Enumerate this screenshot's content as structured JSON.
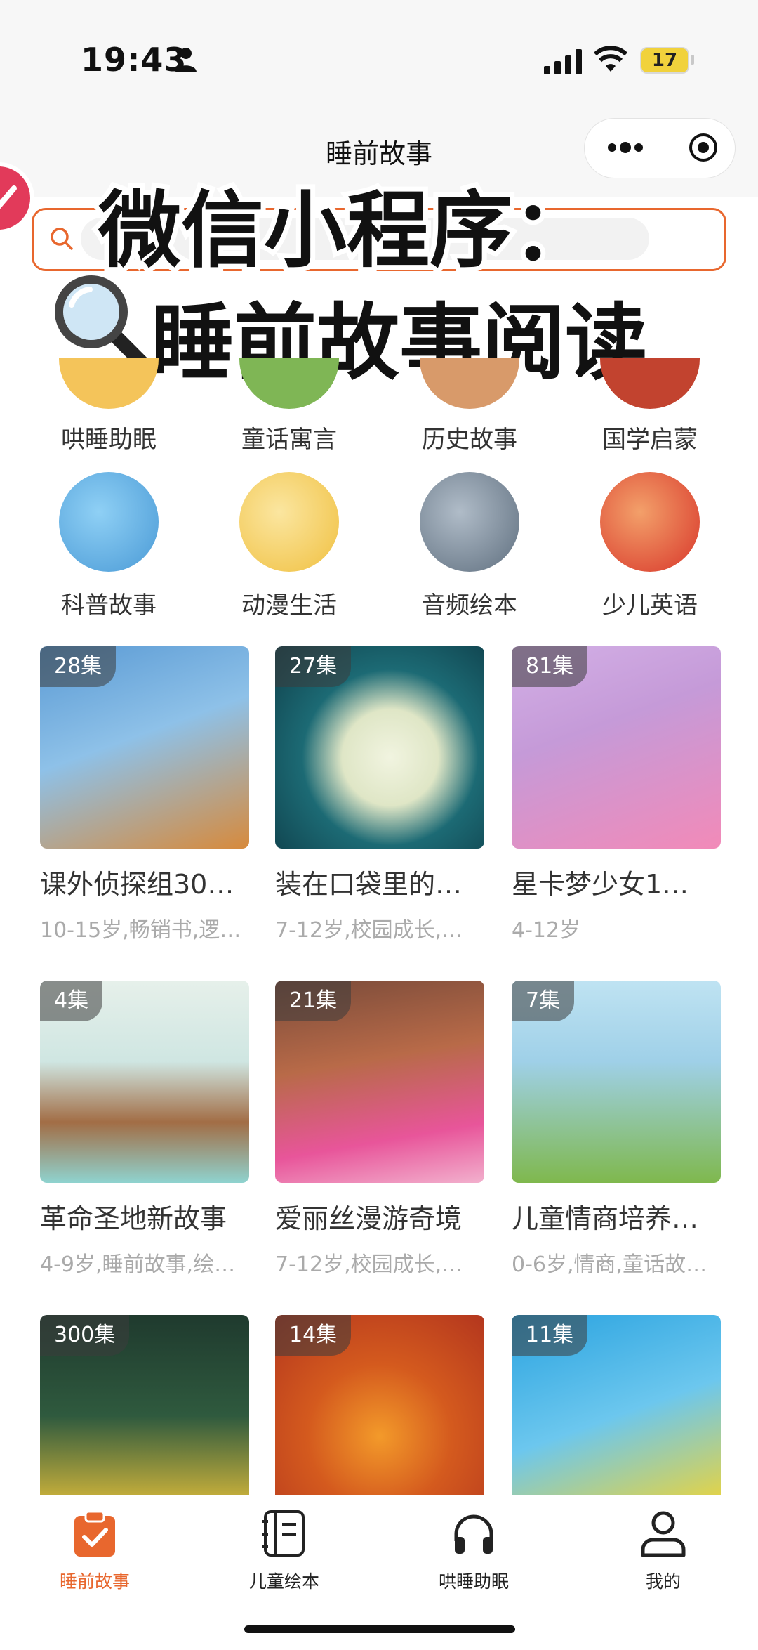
{
  "status_bar": {
    "time": "19:43",
    "battery": "17"
  },
  "nav": {
    "title": "睡前故事"
  },
  "search": {
    "placeholder": ""
  },
  "overlay": {
    "line1": "微信小程序：",
    "line2": "睡前故事阅读"
  },
  "categories": [
    {
      "label": "哄睡助眠",
      "color": "#f4c45a"
    },
    {
      "label": "童话寓言",
      "color": "#7fb655"
    },
    {
      "label": "历史故事",
      "color": "#d89a6a"
    },
    {
      "label": "国学启蒙",
      "color": "#c2432f"
    },
    {
      "label": "科普故事",
      "color": "#4a9ad6"
    },
    {
      "label": "动漫生活",
      "color": "#f0c040"
    },
    {
      "label": "音频绘本",
      "color": "#6f7f8f"
    },
    {
      "label": "少儿英语",
      "color": "#d8362a"
    }
  ],
  "books": [
    {
      "badge": "28集",
      "title": "课外侦探组30…",
      "tags": "10-15岁,畅销书,逻…",
      "c1": "#5a9ad4",
      "c2": "#d78a3c"
    },
    {
      "badge": "27集",
      "title": "装在口袋里的…",
      "tags": "7-12岁,校园成长,…",
      "c1": "#0f4f5f",
      "c2": "#e9eed8"
    },
    {
      "badge": "81集",
      "title": "星卡梦少女1…",
      "tags": "4-12岁",
      "c1": "#c59ad8",
      "c2": "#f28ab8"
    },
    {
      "badge": "4集",
      "title": "革命圣地新故事",
      "tags": "4-9岁,睡前故事,绘…",
      "c1": "#cfe6e2",
      "c2": "#a26d45"
    },
    {
      "badge": "21集",
      "title": "爱丽丝漫游奇境",
      "tags": "7-12岁,校园成长,…",
      "c1": "#7a4b3a",
      "c2": "#e8559a"
    },
    {
      "badge": "7集",
      "title": "儿童情商培养…",
      "tags": "0-6岁,情商,童话故…",
      "c1": "#9fd0e8",
      "c2": "#7fb84d"
    },
    {
      "badge": "300集",
      "title": "",
      "tags": "",
      "c1": "#1f3a2e",
      "c2": "#e9c23a"
    },
    {
      "badge": "14集",
      "title": "",
      "tags": "",
      "c1": "#b3361e",
      "c2": "#f39a2a"
    },
    {
      "badge": "11集",
      "title": "",
      "tags": "",
      "c1": "#2aa3e0",
      "c2": "#f6d52c"
    }
  ],
  "tabs": [
    {
      "label": "睡前故事",
      "active": true
    },
    {
      "label": "儿童绘本",
      "active": false
    },
    {
      "label": "哄睡助眠",
      "active": false
    },
    {
      "label": "我的",
      "active": false
    }
  ],
  "colors": {
    "accent": "#e8672e"
  }
}
